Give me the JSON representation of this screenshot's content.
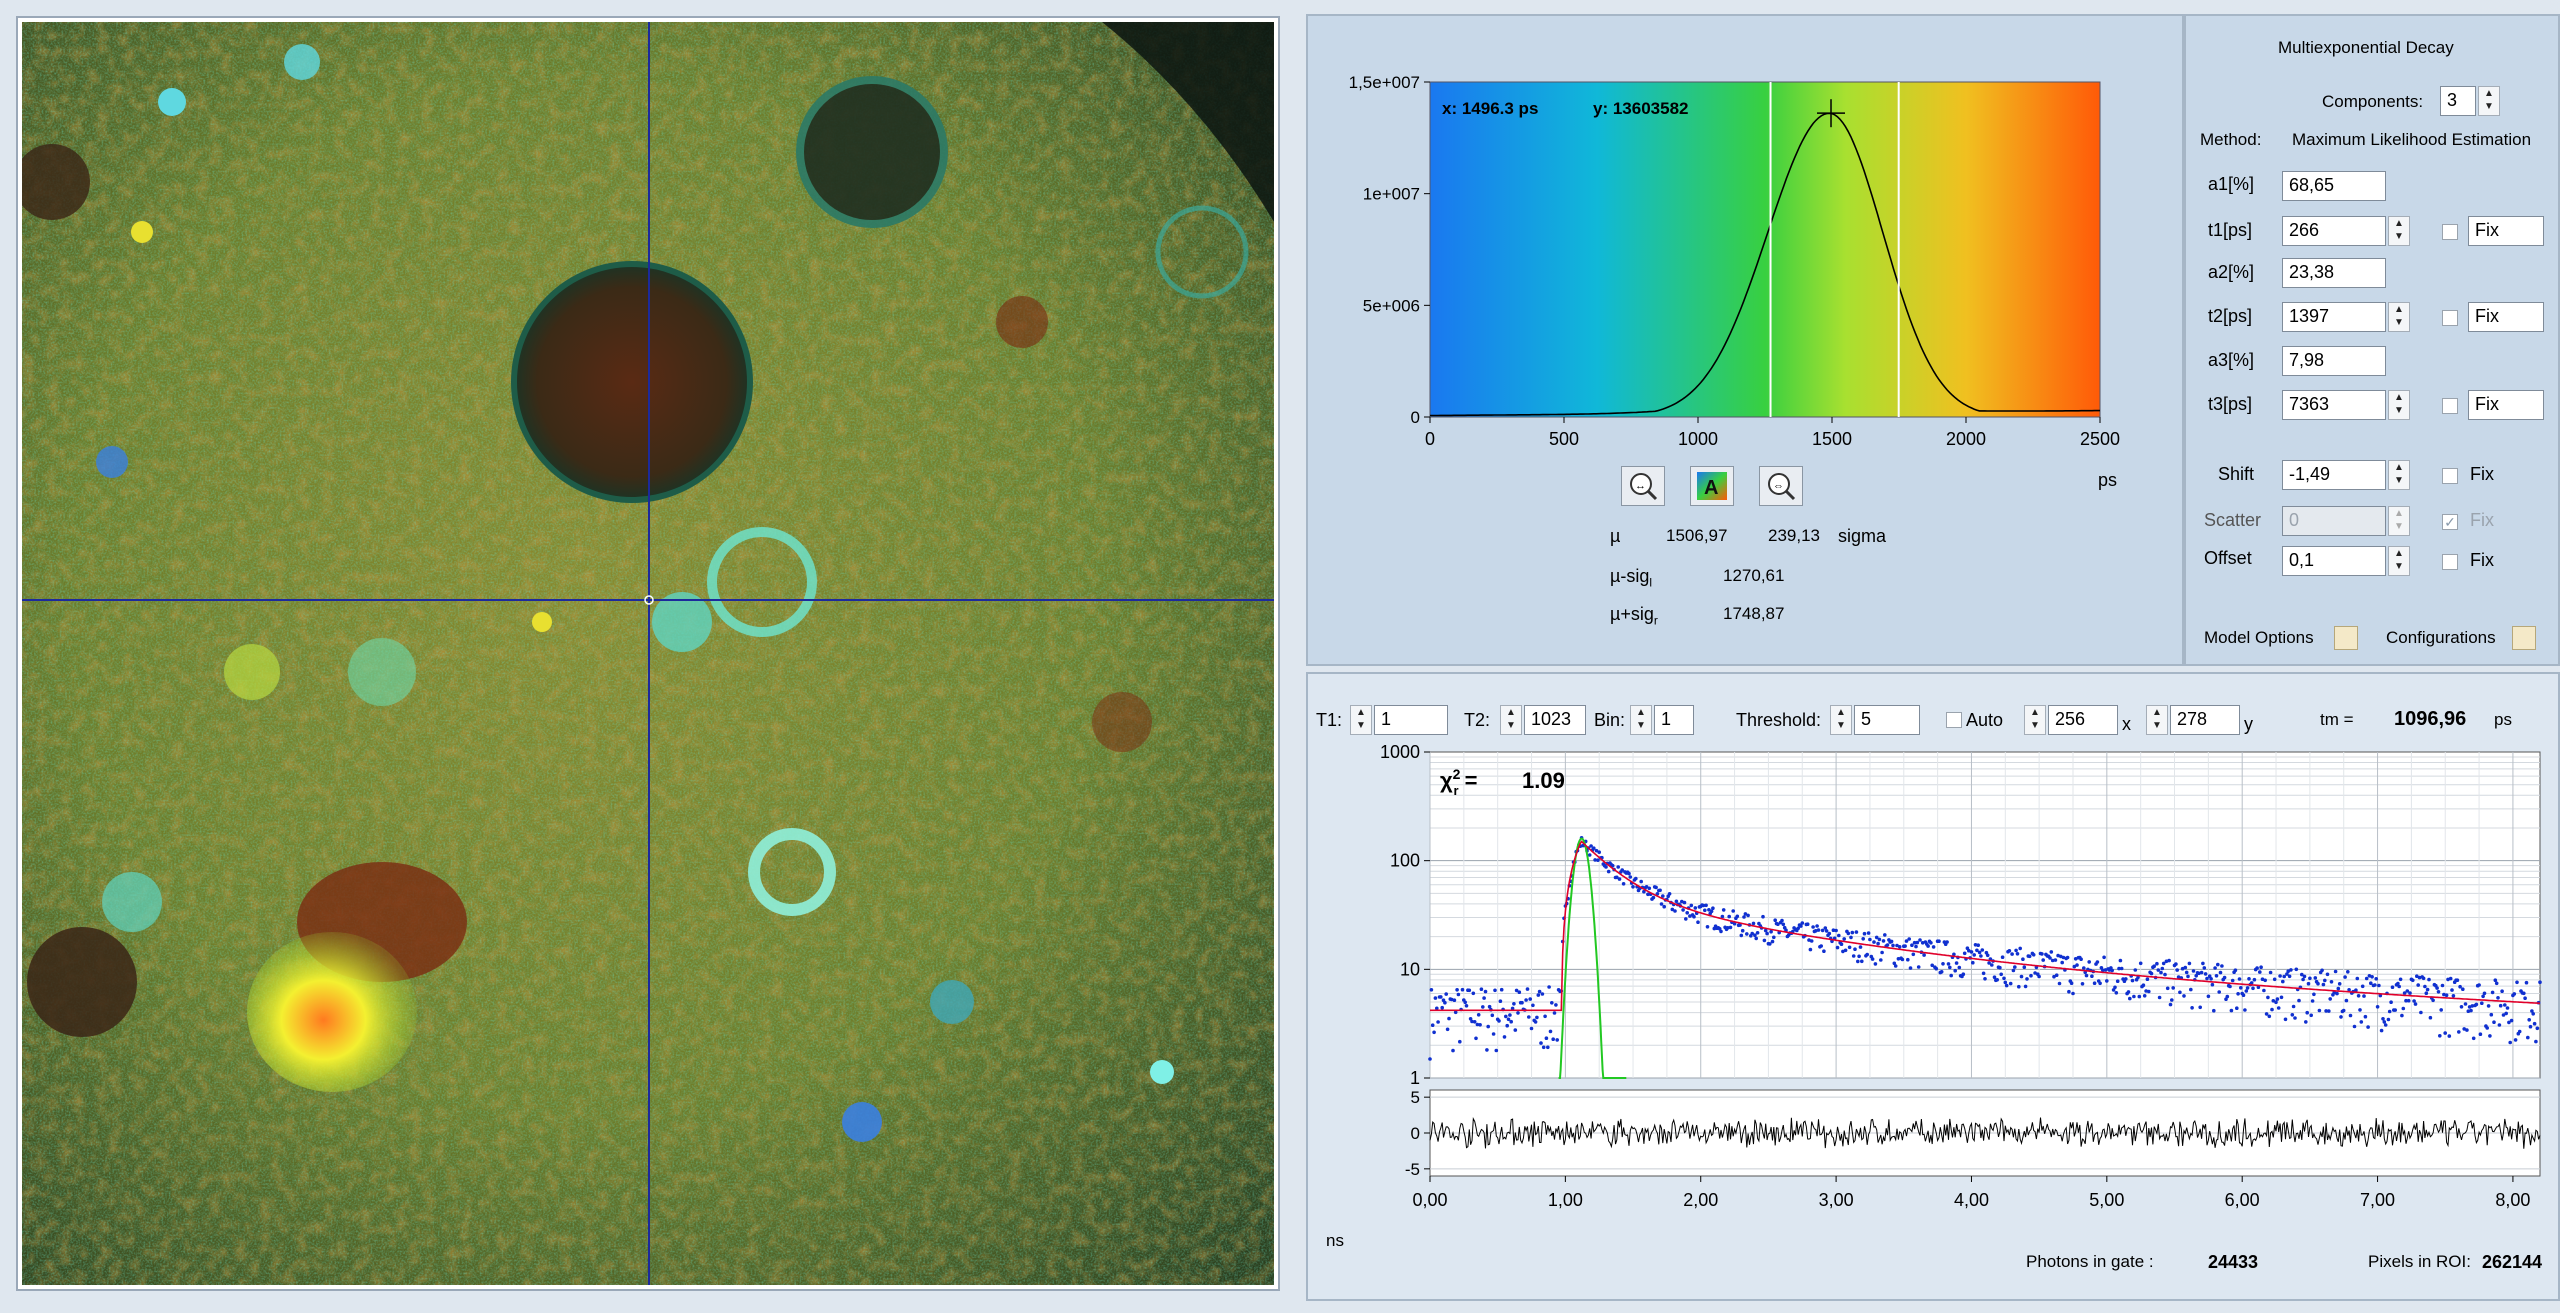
{
  "image": {
    "description_icon": "flim-intensity-image"
  },
  "histogram": {
    "readout_x": "x: 1496.3  ps",
    "readout_y": "y: 13603582",
    "y_ticks": [
      "1,5e+007",
      "1e+007",
      "5e+006",
      "0"
    ],
    "x_ticks": [
      "0",
      "500",
      "1000",
      "1500",
      "2000",
      "2500"
    ],
    "x_unit": "ps",
    "mu_label": "µ",
    "mu_value": "1506,97",
    "sigma_value": "239,13",
    "sigma_label": "sigma",
    "mu_minus_label": "µ-sig",
    "mu_minus_sub": "l",
    "mu_minus_value": "1270,61",
    "mu_plus_label": "µ+sig",
    "mu_plus_sub": "r",
    "mu_plus_value": "1748,87"
  },
  "params": {
    "title": "Multiexponential Decay",
    "components_label": "Components:",
    "components_value": "3",
    "method_label": "Method:",
    "method_value": "Maximum Likelihood Estimation",
    "a1_label": "a1[%]",
    "a1_value": "68,65",
    "t1_label": "t1[ps]",
    "t1_value": "266",
    "a2_label": "a2[%]",
    "a2_value": "23,38",
    "t2_label": "t2[ps]",
    "t2_value": "1397",
    "a3_label": "a3[%]",
    "a3_value": "7,98",
    "t3_label": "t3[ps]",
    "t3_value": "7363",
    "fix_label": "Fix",
    "shift_label": "Shift",
    "shift_value": "-1,49",
    "scatter_label": "Scatter",
    "scatter_value": "0",
    "offset_label": "Offset",
    "offset_value": "0,1",
    "model_options_label": "Model Options",
    "configurations_label": "Configurations"
  },
  "decay": {
    "t1_label": "T1:",
    "t1_value": "1",
    "t2_label": "T2:",
    "t2_value": "1023",
    "bin_label": "Bin:",
    "bin_value": "1",
    "threshold_label": "Threshold:",
    "threshold_value": "5",
    "auto_label": "Auto",
    "x_coord_value": "256",
    "x_coord_label": "x",
    "y_coord_value": "278",
    "y_coord_label": "y",
    "tm_label": "tm =",
    "tm_value": "1096,96",
    "tm_unit": "ps",
    "chi_value": "1.09",
    "y_ticks": [
      "1000",
      "100",
      "10",
      "1"
    ],
    "resid_ticks": [
      "5",
      "0",
      "-5"
    ],
    "x_ticks": [
      "0,00",
      "1,00",
      "2,00",
      "3,00",
      "4,00",
      "5,00",
      "6,00",
      "7,00",
      "8,00"
    ],
    "x_unit": "ns",
    "photons_label": "Photons in gate :",
    "photons_value": "24433",
    "pixels_label": "Pixels in ROI:",
    "pixels_value": "262144"
  },
  "colors": {
    "fit": "#e0002a",
    "data": "#1030d0",
    "irf": "#22c822",
    "cursor": "#1c2a9c"
  }
}
